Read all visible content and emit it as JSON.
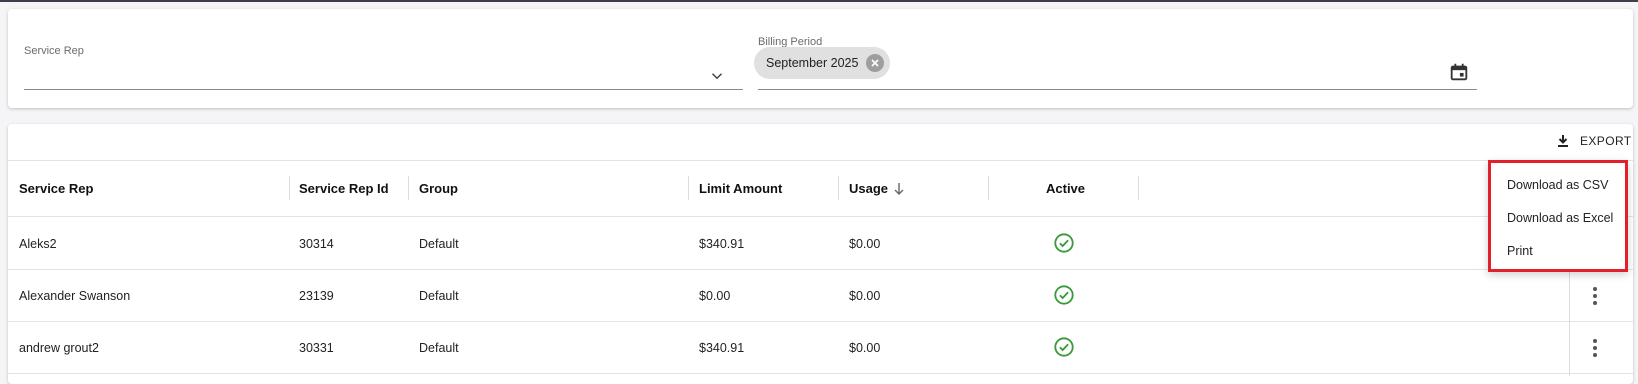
{
  "filters": {
    "service_rep_label": "Service Rep",
    "billing_period_label": "Billing Period",
    "billing_period_chip": "September 2025"
  },
  "toolbar": {
    "export_label": "EXPORT"
  },
  "table": {
    "columns": [
      "Service Rep",
      "Service Rep Id",
      "Group",
      "Limit Amount",
      "Usage",
      "Active"
    ],
    "sorted_column": "Usage",
    "sort_direction": "descending",
    "rows": [
      {
        "service_rep": "Aleks2",
        "service_rep_id": "30314",
        "group": "Default",
        "limit_amount": "$340.91",
        "usage": "$0.00",
        "active": true
      },
      {
        "service_rep": "Alexander Swanson",
        "service_rep_id": "23139",
        "group": "Default",
        "limit_amount": "$0.00",
        "usage": "$0.00",
        "active": true
      },
      {
        "service_rep": "andrew grout2",
        "service_rep_id": "30331",
        "group": "Default",
        "limit_amount": "$340.91",
        "usage": "$0.00",
        "active": true
      }
    ]
  },
  "export_menu": {
    "items": [
      "Download as CSV",
      "Download as Excel",
      "Print"
    ]
  },
  "icons": {
    "chevron": "chevron-down-icon",
    "calendar": "calendar-icon",
    "chip_remove": "close-circle-icon",
    "export": "download-icon",
    "sort": "arrow-down-icon",
    "active": "check-circle-icon",
    "row_menu": "more-vertical-icon"
  },
  "colors": {
    "accent_highlight": "#e3202a",
    "active_check": "#3a9a3a",
    "chip_bg": "#e0e0e0"
  }
}
